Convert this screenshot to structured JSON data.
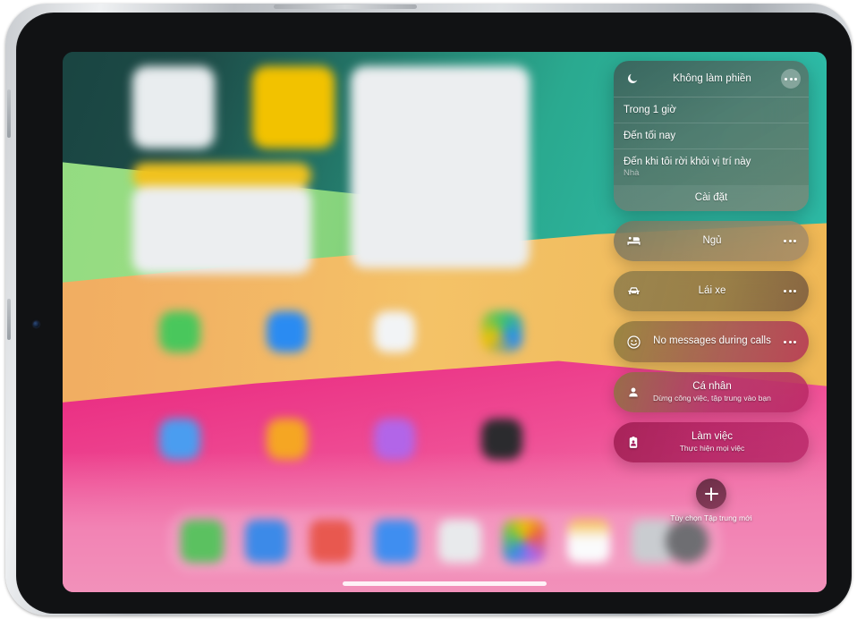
{
  "device": {
    "name": "iPad",
    "bezel_color": "#111214",
    "frame_color": "#c9ccd0"
  },
  "wallpaper": {
    "colors": [
      "#17403e",
      "#2ebba6",
      "#8fd97f",
      "#f2b264",
      "#ea2f83",
      "#f291ba"
    ],
    "description_bands": [
      "teal",
      "green",
      "orange",
      "pink"
    ]
  },
  "home_screen": {
    "blurred": true,
    "widgets": [
      {
        "name": "app-icon-widget-light",
        "color": "#e8ecee"
      },
      {
        "name": "yellow-widget",
        "color": "#f2c200"
      },
      {
        "name": "notes-list-widget",
        "color": "#eceef0"
      },
      {
        "name": "yellow-banner-widget",
        "color": "#f0c21e"
      }
    ],
    "app_icons_row1": [
      "#49c75c",
      "#2a8bf2",
      "#f2f4f6",
      "#3ec46d"
    ],
    "app_icons_row2": [
      "#4a9df0",
      "#f5a623",
      "#b265e8",
      "#2b2b2e"
    ],
    "dock_icons": [
      "#5bc160",
      "#3c8ae8",
      "#e8584f",
      "#3f8ef0",
      "#e8eaec",
      "#d8dade",
      "#f2f3f5",
      "#c9ccd0"
    ]
  },
  "control_center": {
    "dnd_panel": {
      "icon": "moon-icon",
      "title": "Không làm phiền",
      "more_button": "ellipsis-icon",
      "options": [
        {
          "label": "Trong 1 giờ",
          "sub": ""
        },
        {
          "label": "Đến tối nay",
          "sub": ""
        },
        {
          "label": "Đến khi tôi rời khỏi vị trí này",
          "sub": "Nhà"
        }
      ],
      "settings_label": "Cài đặt"
    },
    "focus_modes": [
      {
        "icon": "bed-icon",
        "name": "Ngủ",
        "desc": "",
        "more": "ellipsis-icon"
      },
      {
        "icon": "car-icon",
        "name": "Lái xe",
        "desc": "",
        "more": "ellipsis-icon"
      },
      {
        "icon": "smiley-icon",
        "name": "No messages during calls",
        "desc": "",
        "more": "ellipsis-icon"
      },
      {
        "icon": "person-icon",
        "name": "Cá nhân",
        "desc": "Dừng công việc, tập trung vào bạn",
        "more": ""
      },
      {
        "icon": "badge-icon",
        "name": "Làm việc",
        "desc": "Thực hiện mọi việc",
        "more": ""
      }
    ],
    "new_focus": {
      "button_icon": "plus-icon",
      "label": "Tùy chọn Tập trung mới"
    }
  }
}
